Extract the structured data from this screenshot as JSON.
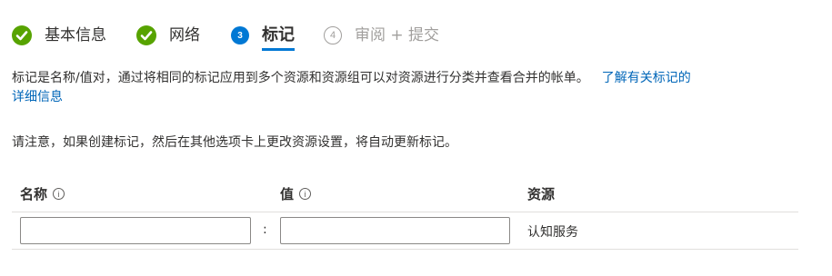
{
  "wizard": {
    "steps": [
      {
        "label": "基本信息",
        "state": "done"
      },
      {
        "label": "网络",
        "state": "done"
      },
      {
        "number": "3",
        "label": "标记",
        "state": "current"
      },
      {
        "number": "4",
        "label": "审阅 + 提交",
        "state": "pending"
      }
    ]
  },
  "description": {
    "text": "标记是名称/值对，通过将相同的标记应用到多个资源和资源组可以对资源进行分类并查看合并的帐单。",
    "link_line1": "了解有关标记的",
    "link_line2": "详细信息"
  },
  "note": "请注意，如果创建标记，然后在其他选项卡上更改资源设置，将自动更新标记。",
  "table": {
    "headers": {
      "name": "名称",
      "value": "值",
      "resource": "资源"
    },
    "info_glyph": "i",
    "colon": ":",
    "rows": [
      {
        "name": "",
        "value": "",
        "resource": "认知服务"
      }
    ]
  },
  "colors": {
    "done": "#57a300",
    "current": "#0078d4",
    "pending": "#a19f9d",
    "link": "#0066b8"
  }
}
